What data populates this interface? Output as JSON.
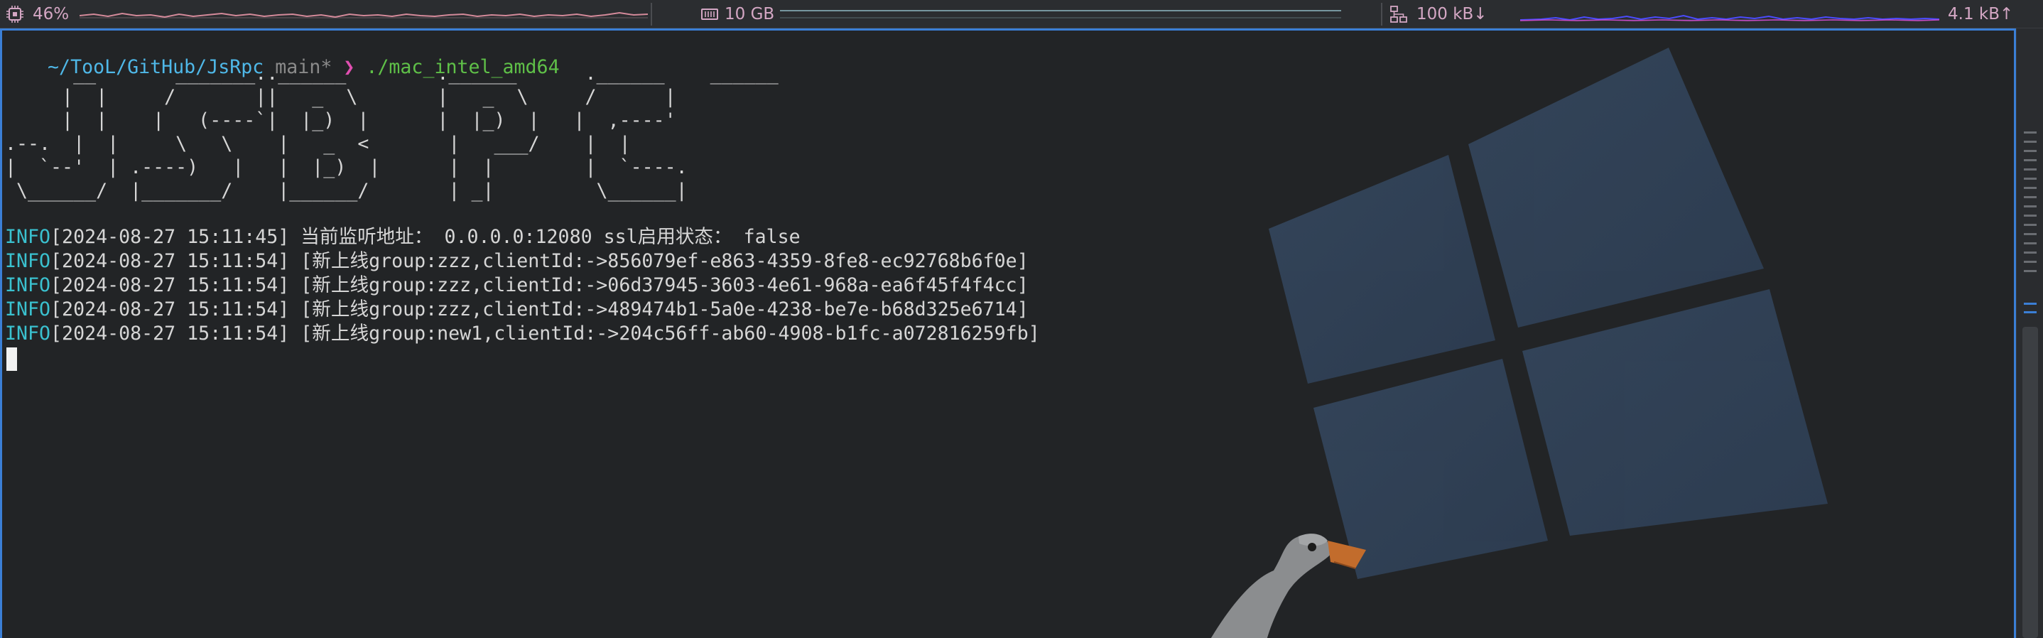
{
  "status_bar": {
    "cpu": {
      "icon": "cpu-icon",
      "value": "46%"
    },
    "memory": {
      "icon": "memory-icon",
      "value": "10 GB"
    },
    "network": {
      "icon": "network-icon",
      "down": "100 kB↓",
      "up": "4.1 kB↑"
    }
  },
  "terminal": {
    "prompt": {
      "directory": "~/TooL/GitHub/JsRpc",
      "branch": "main*",
      "arrow": "❯",
      "command": "./mac_intel_amd64"
    },
    "ascii_art": "      __       _______..______        .______      .______    ______\n     |  |     /       ||   _  \\       |   _  \\     /      |\n     |  |    |   (----`|  |_)  |      |  |_)  |   |  ,----'\n.--.  |  |     \\   \\    |   _  <       |   ___/    |  |\n|  `--'  | .----)   |   |  |_)  |      |  |        |  `----.\n \\______/  |_______/    |______/       | _|         \\______|",
    "log_lines": [
      {
        "level": "INFO",
        "text": "[2024-08-27 15:11:45] 当前监听地址： 0.0.0.0:12080 ssl启用状态： false"
      },
      {
        "level": "INFO",
        "text": "[2024-08-27 15:11:54] [新上线group:zzz,clientId:->856079ef-e863-4359-8fe8-ec92768b6f0e]"
      },
      {
        "level": "INFO",
        "text": "[2024-08-27 15:11:54] [新上线group:zzz,clientId:->06d37945-3603-4e61-968a-ea6f45f4f4cc]"
      },
      {
        "level": "INFO",
        "text": "[2024-08-27 15:11:54] [新上线group:zzz,clientId:->489474b1-5a0e-4238-be7e-b68d325e6714]"
      },
      {
        "level": "INFO",
        "text": "[2024-08-27 15:11:54] [新上线group:new1,clientId:->204c56ff-ab60-4908-b1fc-a072816259fb]"
      }
    ]
  },
  "colors": {
    "accent_border": "#3b7fd6",
    "info": "#3ac1cf",
    "prompt_dir": "#4fb8e8",
    "prompt_cmd": "#5fc048",
    "prompt_arrow": "#e04fb0"
  }
}
